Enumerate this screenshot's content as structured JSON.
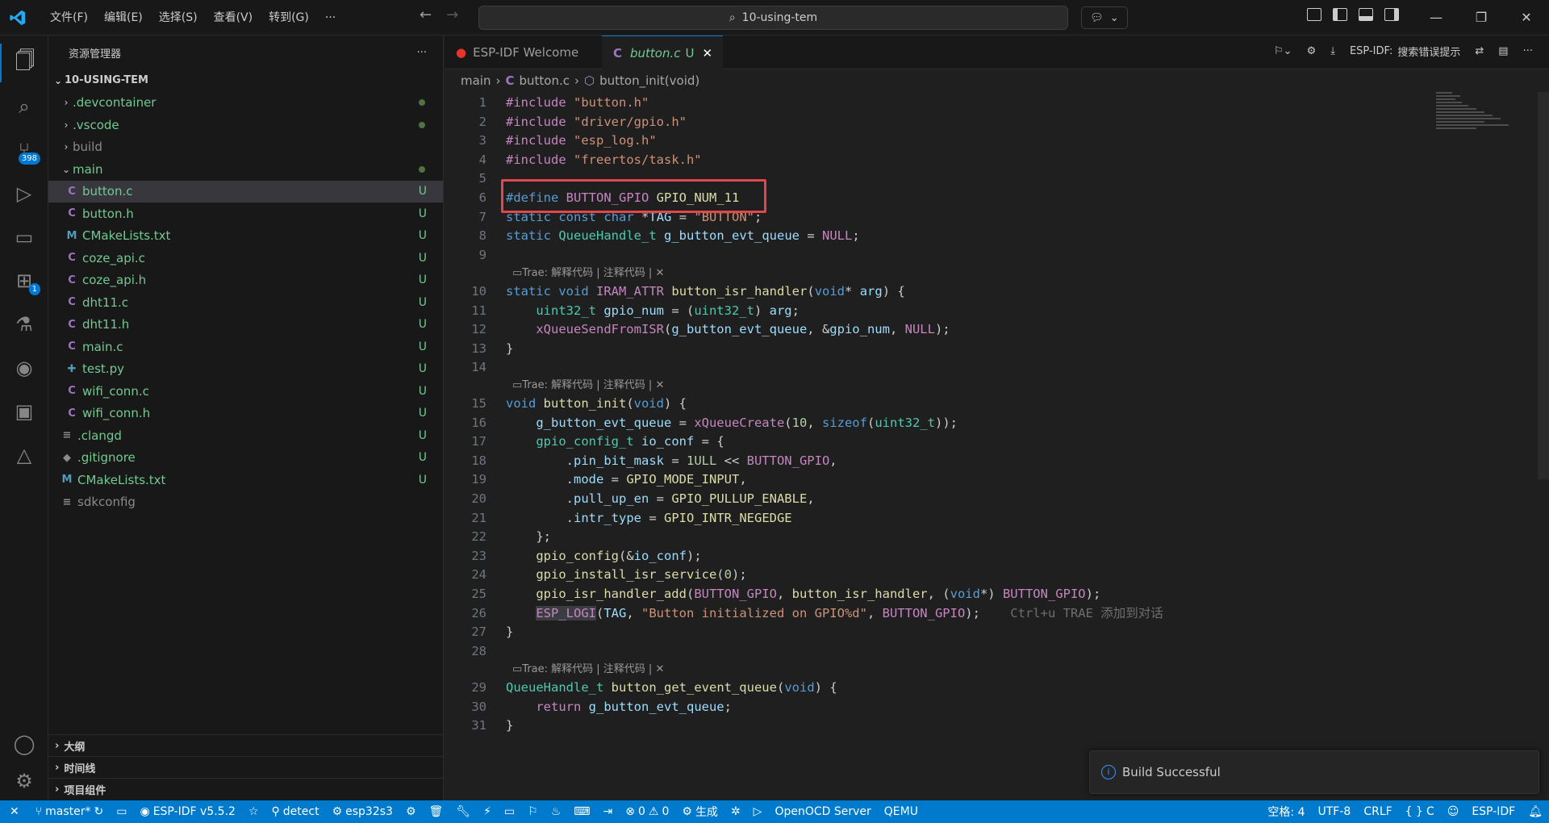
{
  "titlebar": {
    "menu": [
      "文件(F)",
      "编辑(E)",
      "选择(S)",
      "查看(V)",
      "转到(G)",
      "···"
    ],
    "search_text": "10-using-tem"
  },
  "activity": {
    "scm_badge": "398",
    "ext_badge": "1"
  },
  "sidebar": {
    "title": "资源管理器",
    "more": "···",
    "root": "10-USING-TEM",
    "items": [
      {
        "label": ".devcontainer",
        "kind": "folder",
        "status": "dot"
      },
      {
        "label": ".vscode",
        "kind": "folder",
        "status": "dot"
      },
      {
        "label": "build",
        "kind": "folder",
        "status": ""
      },
      {
        "label": "main",
        "kind": "folder-open",
        "status": "dot"
      },
      {
        "label": "button.c",
        "kind": "c",
        "status": "U"
      },
      {
        "label": "button.h",
        "kind": "c",
        "status": "U"
      },
      {
        "label": "CMakeLists.txt",
        "kind": "m",
        "status": "U"
      },
      {
        "label": "coze_api.c",
        "kind": "c",
        "status": "U"
      },
      {
        "label": "coze_api.h",
        "kind": "c",
        "status": "U"
      },
      {
        "label": "dht11.c",
        "kind": "c",
        "status": "U"
      },
      {
        "label": "dht11.h",
        "kind": "c",
        "status": "U"
      },
      {
        "label": "main.c",
        "kind": "c",
        "status": "U"
      },
      {
        "label": "test.py",
        "kind": "py",
        "status": "U"
      },
      {
        "label": "wifi_conn.c",
        "kind": "c",
        "status": "U"
      },
      {
        "label": "wifi_conn.h",
        "kind": "c",
        "status": "U"
      },
      {
        "label": ".clangd",
        "kind": "lines",
        "status": "U"
      },
      {
        "label": ".gitignore",
        "kind": "git",
        "status": "U"
      },
      {
        "label": "CMakeLists.txt",
        "kind": "m",
        "status": "U"
      },
      {
        "label": "sdkconfig",
        "kind": "lines",
        "status": ""
      }
    ],
    "sections": [
      "大纲",
      "时间线",
      "项目组件"
    ]
  },
  "tabs": [
    {
      "label": "ESP-IDF Welcome",
      "active": false
    },
    {
      "label": "button.c",
      "active": true,
      "status": "U"
    }
  ],
  "editor_actions": {
    "esp_label": "ESP-IDF:",
    "esp_search": "搜索错误提示"
  },
  "breadcrumb": [
    "main",
    "button.c",
    "button_init(void)"
  ],
  "codelens": "Trae: 解释代码 | 注释代码 | ✕",
  "ghost_hint": "Ctrl+u TRAE 添加到对话",
  "line_numbers": [
    "1",
    "2",
    "3",
    "4",
    "5",
    "6",
    "7",
    "8",
    "9",
    "10",
    "11",
    "12",
    "13",
    "14",
    "15",
    "16",
    "17",
    "18",
    "19",
    "20",
    "21",
    "22",
    "23",
    "24",
    "25",
    "26",
    "27",
    "28",
    "29",
    "30",
    "31"
  ],
  "toast": {
    "message": "Build Successful",
    "icon": "info-icon"
  },
  "statusbar": {
    "branch": "master*",
    "idf_version": "ESP-IDF v5.5.2",
    "detect": "detect",
    "target": "esp32s3",
    "errors": "0",
    "warnings": "0",
    "build": "生成",
    "openocd": "OpenOCD Server",
    "qemu": "QEMU",
    "spaces": "空格: 4",
    "encoding": "UTF-8",
    "eol": "CRLF",
    "language": "C",
    "esp_idf": "ESP-IDF"
  },
  "colors": {
    "accent": "#0078d4",
    "statusbar": "#007acc",
    "highlight_box": "#e0474c",
    "untracked": "#73c991"
  }
}
